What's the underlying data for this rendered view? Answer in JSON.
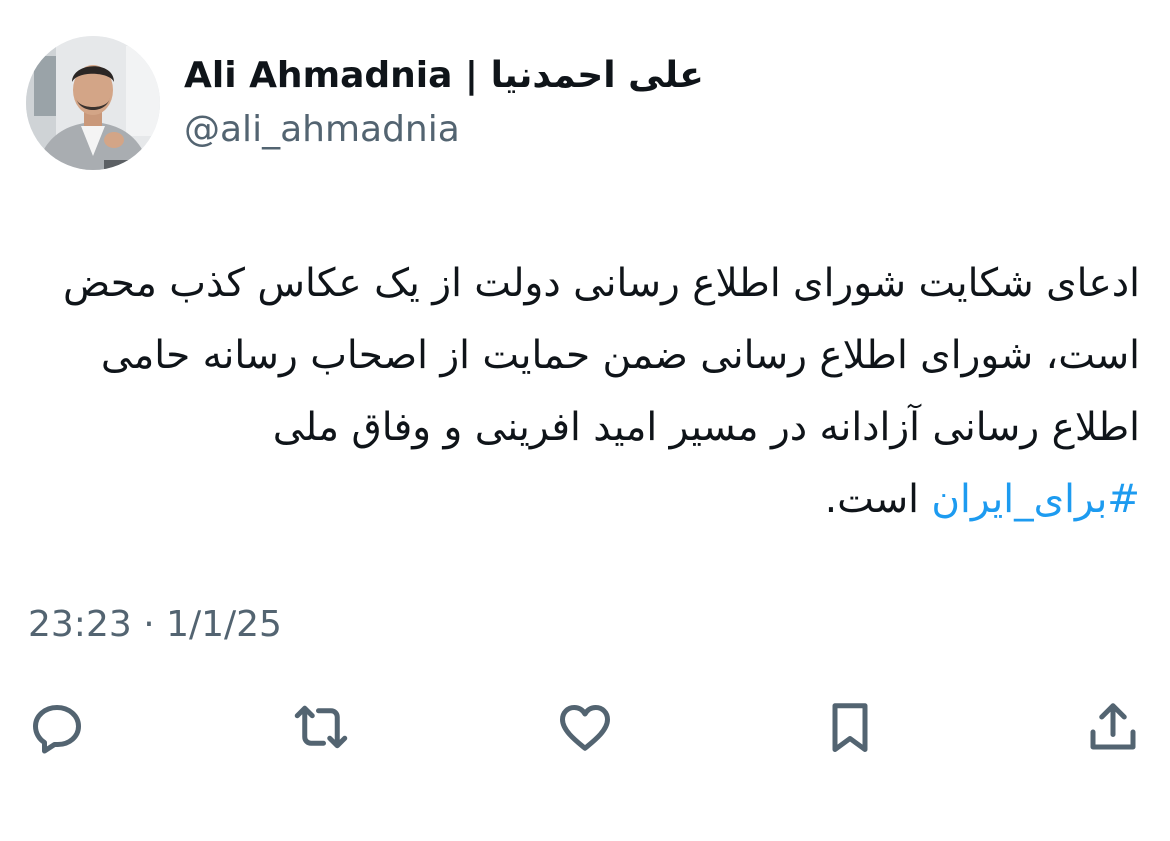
{
  "author": {
    "display_name": "Ali Ahmadnia | علی احمدنیا",
    "handle": "@ali_ahmadnia"
  },
  "tweet": {
    "text_before_hashtag": "ادعای شکایت شورای اطلاع رسانی دولت از یک عکاس کذب محض است، شورای اطلاع رسانی ضمن حمایت از اصحاب رسانه حامی اطلاع رسانی آزادانه در مسیر امید افرینی و وفاق ملی ",
    "hashtag": "#برای_ایران",
    "text_after_hashtag": " است."
  },
  "meta": {
    "timestamp": "23:23 · 1/1/25"
  },
  "actions": {
    "reply_icon": "reply-icon",
    "retweet_icon": "retweet-icon",
    "like_icon": "heart-icon",
    "bookmark_icon": "bookmark-icon",
    "share_icon": "share-icon"
  },
  "colors": {
    "text": "#0f1419",
    "secondary": "#536471",
    "link": "#1d9bf0"
  }
}
